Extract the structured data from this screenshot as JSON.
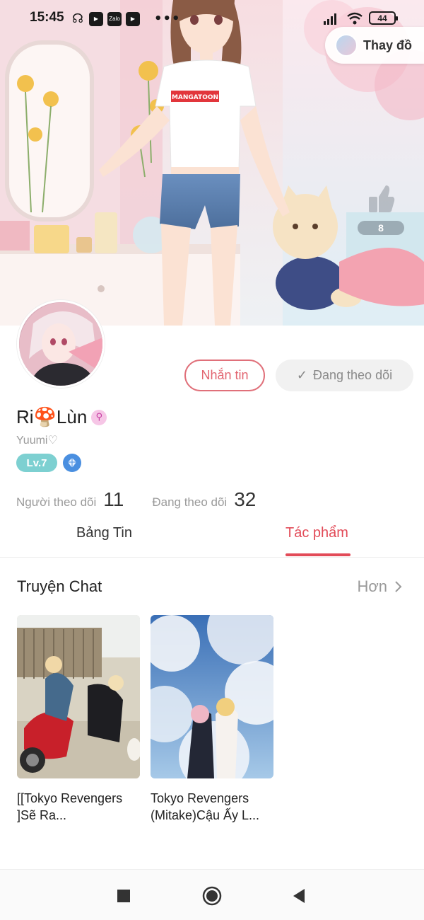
{
  "status_bar": {
    "time": "15:45",
    "notif_icons": [
      {
        "icon": "headphones-icon",
        "glyph": "☊"
      },
      {
        "icon": "video-app-icon",
        "glyph": "▶"
      },
      {
        "icon": "zalo-icon",
        "glyph": "Zalo"
      },
      {
        "icon": "youtube-icon",
        "glyph": "▶"
      }
    ],
    "more": "•••",
    "battery": "44"
  },
  "hero": {
    "change_label": "Thay đồ",
    "like_count": "8",
    "shirt_text": "MANGATOON"
  },
  "profile": {
    "name": "Ri🍄Lùn",
    "gender_glyph": "⚲",
    "username": "Yuumi♡",
    "level": "Lv.7",
    "message_button": "Nhắn tin",
    "following_button": "Đang theo dõi",
    "followers_label": "Người theo dõi",
    "followers_count": "11",
    "following_label": "Đang theo dõi",
    "following_count": "32"
  },
  "tabs": {
    "feed": "Bảng Tin",
    "works": "Tác phẩm"
  },
  "section": {
    "title": "Truyện Chat",
    "more": "Hơn"
  },
  "cards": [
    {
      "title": "[[Tokyo Revengers ]Sẽ Ra..."
    },
    {
      "title": "Tokyo Revengers (Mitake)Cậu Ấy L..."
    }
  ],
  "colors": {
    "accent": "#e24b58",
    "level_badge": "#7dd0d1",
    "diamond_badge": "#4a8fe0"
  }
}
